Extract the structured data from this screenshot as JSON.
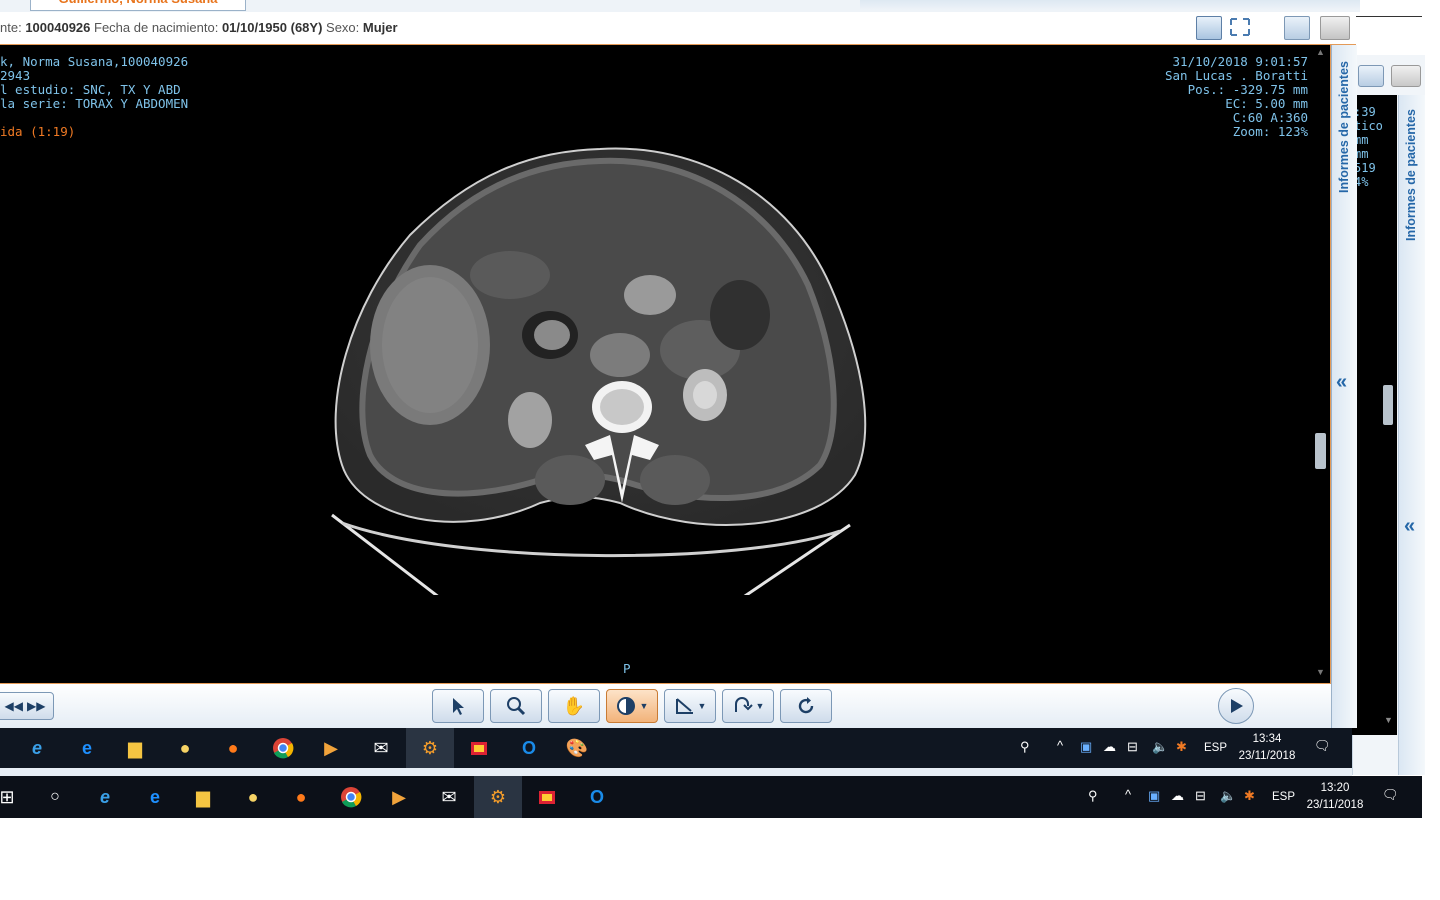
{
  "header": {
    "patient_tab": "Guillermo, Norma Susana",
    "id_label": "nte:",
    "id_value": "100040926",
    "dob_label": "Fecha de nacimiento:",
    "dob_value": "01/10/1950 (68Y)",
    "sex_label": "Sexo:",
    "sex_value": "Mujer"
  },
  "overlay": {
    "left": [
      "k, Norma Susana,100040926",
      "2943",
      "l estudio: SNC, TX Y ABD",
      "la serie: TORAX Y ABDOMEN"
    ],
    "left_warning": "ida (1:19)",
    "right": [
      "31/10/2018 9:01:57",
      "San Lucas . Boratti",
      "Pos.: -329.75 mm",
      "EC: 5.00 mm",
      "C:60 A:360",
      "Zoom: 123%"
    ],
    "orientation": "P"
  },
  "background_overlay": [
    ":39",
    "tico",
    "mm",
    "mm",
    "519",
    "4%"
  ],
  "side_panel": {
    "label": "Informes de pacientes",
    "collapse": "«"
  },
  "background_panel": {
    "label": "Informes de pacientes",
    "collapse": "«"
  },
  "taskbar_inner": {
    "lang": "ESP",
    "time": "13:34",
    "date": "23/11/2018"
  },
  "taskbar_outer": {
    "lang": "ESP",
    "time": "13:20",
    "date": "23/11/2018"
  },
  "colors": {
    "accent": "#e49a57",
    "overlay_text": "#7fc3ea",
    "warning_text": "#f07a24"
  },
  "icons": {
    "toolbar": [
      "rewind-icon",
      "fast-forward-icon",
      "pointer-icon",
      "zoom-icon",
      "pan-hand-icon",
      "window-level-icon",
      "measure-icon",
      "rotate-icon",
      "reset-icon",
      "play-icon"
    ]
  }
}
